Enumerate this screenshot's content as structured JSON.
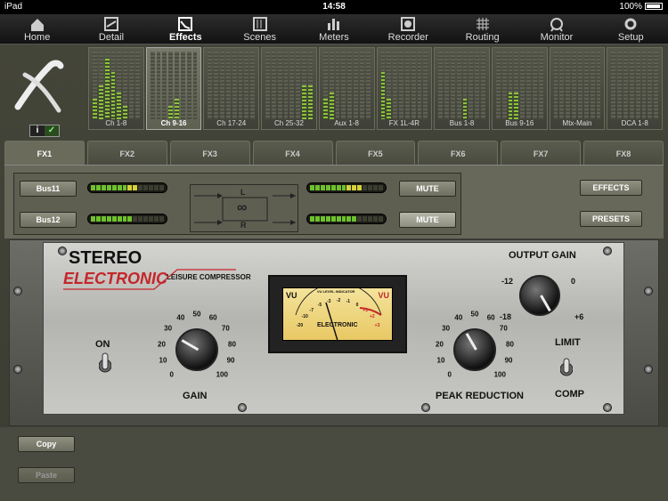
{
  "status": {
    "device": "iPad",
    "time": "14:58",
    "battery": "100%"
  },
  "nav": {
    "items": [
      {
        "label": "Home",
        "icon": "home-icon"
      },
      {
        "label": "Detail",
        "icon": "detail-icon"
      },
      {
        "label": "Effects",
        "icon": "effects-icon",
        "active": true
      },
      {
        "label": "Scenes",
        "icon": "scenes-icon"
      },
      {
        "label": "Meters",
        "icon": "meters-icon"
      },
      {
        "label": "Recorder",
        "icon": "recorder-icon"
      },
      {
        "label": "Routing",
        "icon": "routing-icon"
      },
      {
        "label": "Monitor",
        "icon": "monitor-icon"
      },
      {
        "label": "Setup",
        "icon": "setup-icon"
      }
    ]
  },
  "strips": [
    {
      "label": "Ch 1-8",
      "levels": [
        0.3,
        0.5,
        0.9,
        0.7,
        0.4,
        0.2,
        0.0,
        0.0
      ]
    },
    {
      "label": "Ch 9-16",
      "levels": [
        0.0,
        0.0,
        0.0,
        0.2,
        0.3,
        0.0,
        0.0,
        0.0
      ],
      "selected": true
    },
    {
      "label": "Ch 17-24",
      "levels": [
        0,
        0,
        0,
        0,
        0,
        0,
        0,
        0
      ]
    },
    {
      "label": "Ch 25-32",
      "levels": [
        0,
        0,
        0,
        0,
        0,
        0,
        0.5,
        0.5
      ]
    },
    {
      "label": "Aux 1-8",
      "levels": [
        0.3,
        0.4,
        0,
        0,
        0,
        0,
        0,
        0
      ]
    },
    {
      "label": "FX 1L-4R",
      "levels": [
        0.7,
        0.3,
        0,
        0,
        0,
        0,
        0,
        0
      ]
    },
    {
      "label": "Bus 1-8",
      "levels": [
        0,
        0,
        0,
        0,
        0.3,
        0,
        0,
        0
      ]
    },
    {
      "label": "Bus 9-16",
      "levels": [
        0,
        0,
        0.4,
        0.4,
        0,
        0,
        0,
        0
      ]
    },
    {
      "label": "Mtx-Main",
      "levels": [
        0,
        0,
        0,
        0,
        0,
        0,
        0,
        0
      ]
    },
    {
      "label": "DCA 1-8",
      "levels": [
        0,
        0,
        0,
        0,
        0,
        0,
        0,
        0
      ]
    }
  ],
  "info": {
    "icon": "info-icon",
    "wifi": "wifi-icon"
  },
  "tabs": [
    "FX1",
    "FX2",
    "FX3",
    "FX4",
    "FX5",
    "FX6",
    "FX7",
    "FX8"
  ],
  "routing": {
    "input1": "Bus11",
    "input2": "Bus12",
    "mute1": "MUTE",
    "mute2": "MUTE",
    "diagram_l": "L",
    "diagram_r": "R",
    "link_symbol": "∞"
  },
  "buttons": {
    "effects": "EFFECTS",
    "presets": "PRESETS",
    "copy": "Copy",
    "paste": "Paste"
  },
  "compressor": {
    "title1": "STEREO",
    "title2": "ELECTRONIC",
    "subtitle": "LEISURE COMPRESSOR",
    "on_label": "ON",
    "gain_label": "GAIN",
    "gain_scale": [
      "0",
      "10",
      "20",
      "30",
      "40",
      "50",
      "60",
      "70",
      "80",
      "90",
      "100"
    ],
    "output_gain_label": "OUTPUT GAIN",
    "output_scale": [
      "-18",
      "-12",
      "0",
      "+6"
    ],
    "peak_reduction_label": "PEAK REDUCTION",
    "peak_scale": [
      "0",
      "10",
      "20",
      "30",
      "40",
      "50",
      "60",
      "70",
      "80",
      "90",
      "100"
    ],
    "limit_label": "LIMIT",
    "comp_label": "COMP",
    "vu": {
      "left": "VU",
      "right": "VU",
      "top": "VU LEVEL INDICATOR",
      "brand": "ELECTRONIC",
      "scale": [
        "-20",
        "-10",
        "-7",
        "-5",
        "-3",
        "-2",
        "-1",
        "0",
        "+1",
        "+2",
        "+3"
      ]
    }
  }
}
